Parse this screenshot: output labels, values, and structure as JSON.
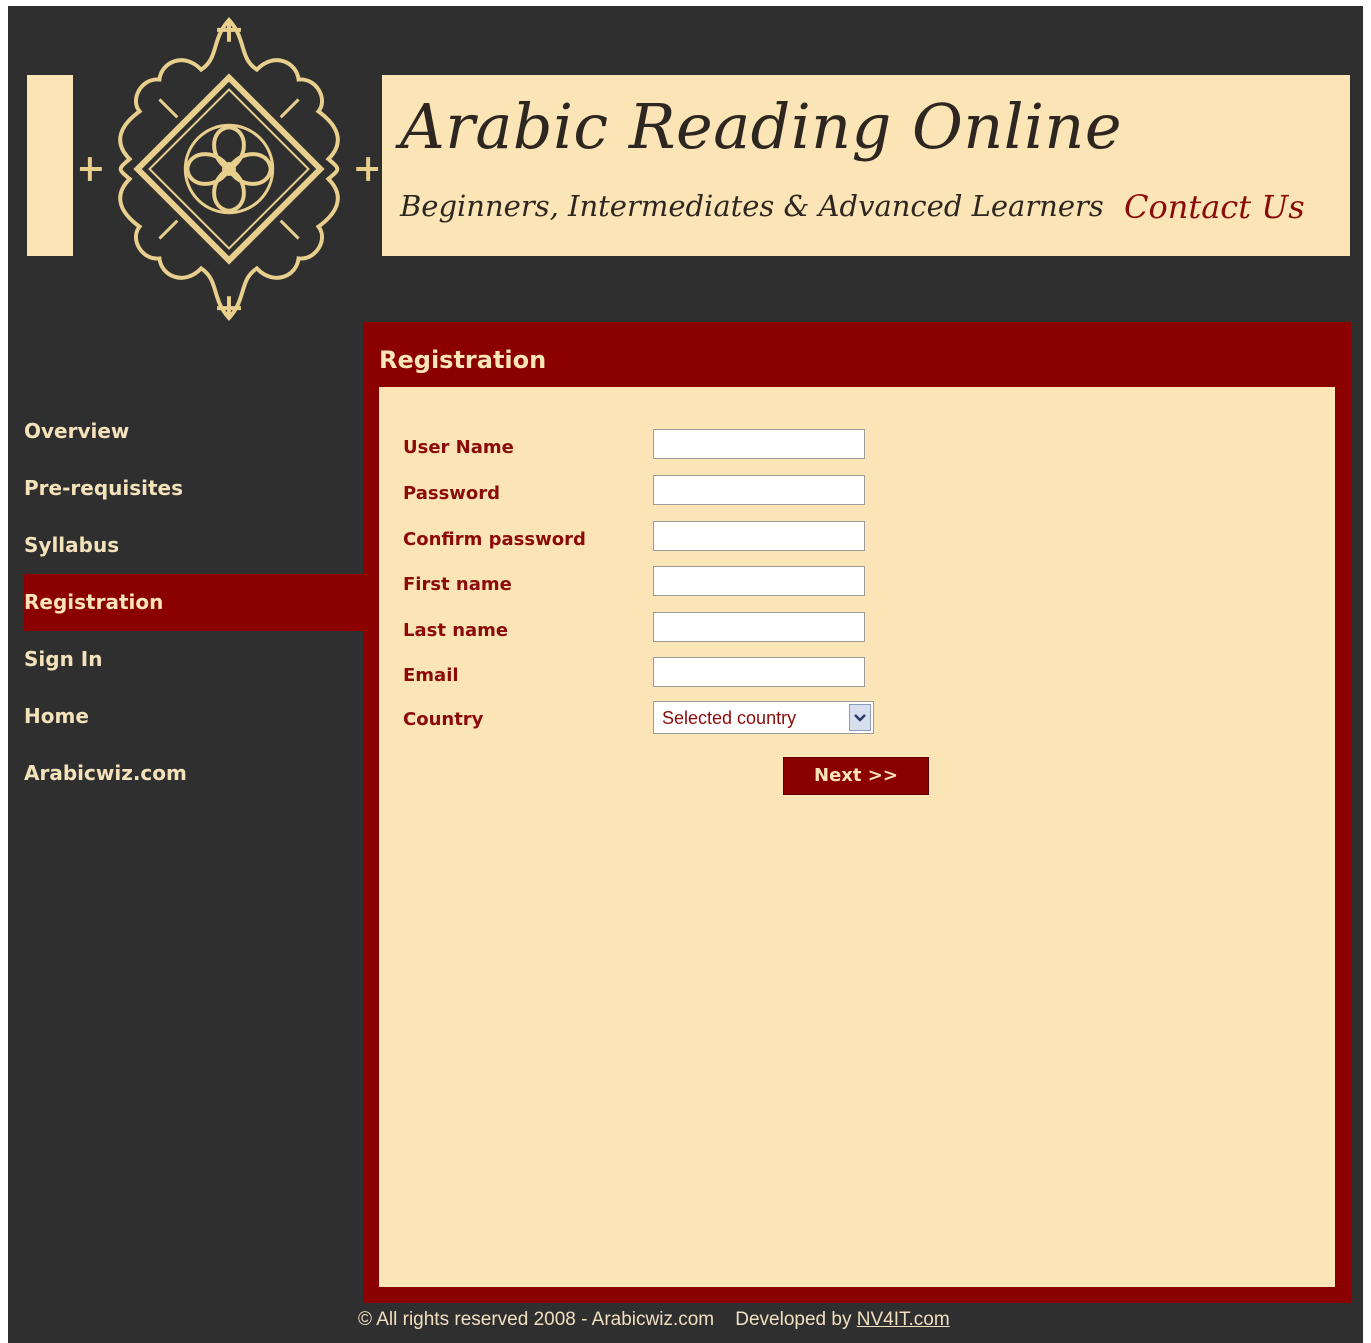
{
  "header": {
    "title": "Arabic Reading Online",
    "subtitle": "Beginners, Intermediates & Advanced Learners",
    "contact_link": "Contact Us"
  },
  "colors": {
    "background_dark": "#2f2f2f",
    "cream": "#fbe5b6",
    "maroon": "#8b0000"
  },
  "sidebar": {
    "items": [
      {
        "label": "Overview",
        "active": false
      },
      {
        "label": "Pre-requisites",
        "active": false
      },
      {
        "label": "Syllabus",
        "active": false
      },
      {
        "label": "Registration",
        "active": true
      },
      {
        "label": "Sign In",
        "active": false
      },
      {
        "label": "Home",
        "active": false
      },
      {
        "label": "Arabicwiz.com",
        "active": false
      }
    ]
  },
  "main": {
    "title": "Registration",
    "form": {
      "fields": [
        {
          "label": "User Name",
          "value": ""
        },
        {
          "label": "Password",
          "value": ""
        },
        {
          "label": "Confirm password",
          "value": ""
        },
        {
          "label": "First name",
          "value": ""
        },
        {
          "label": "Last name",
          "value": ""
        },
        {
          "label": "Email",
          "value": ""
        }
      ],
      "country_label": "Country",
      "country_selected": "Selected country",
      "next_button": "Next >>"
    }
  },
  "footer": {
    "copyright": "© All rights reserved 2008 - Arabicwiz.com",
    "developed_by": "Developed by",
    "developer_link": "NV4IT.com"
  }
}
